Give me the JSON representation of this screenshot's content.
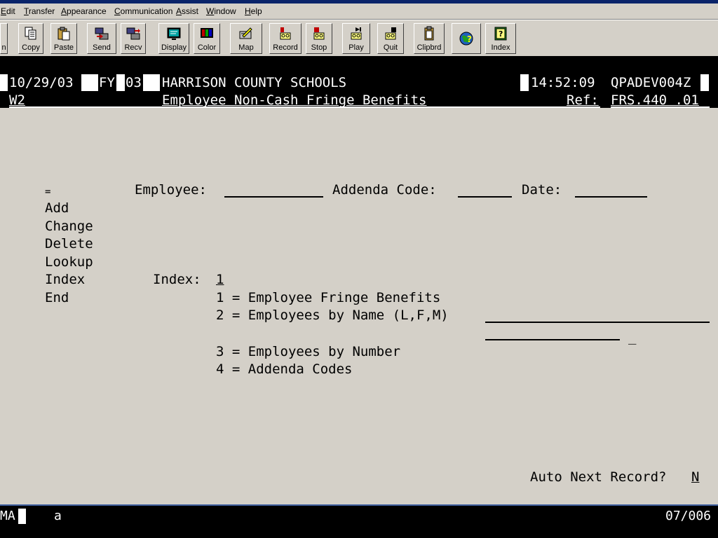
{
  "menu": {
    "items": [
      "Edit",
      "Transfer",
      "Appearance",
      "Communication",
      "Assist",
      "Window",
      "Help"
    ]
  },
  "toolbar": {
    "buttons": [
      {
        "label": "n",
        "icon": "open-icon"
      },
      {
        "label": "Copy",
        "icon": "copy-icon"
      },
      {
        "label": "Paste",
        "icon": "paste-icon"
      },
      {
        "label": "Send",
        "icon": "send-icon"
      },
      {
        "label": "Recv",
        "icon": "receive-icon"
      },
      {
        "label": "Display",
        "icon": "display-icon"
      },
      {
        "label": "Color",
        "icon": "color-icon"
      },
      {
        "label": "Map",
        "icon": "map-icon"
      },
      {
        "label": "Record",
        "icon": "record-icon"
      },
      {
        "label": "Stop",
        "icon": "stop-icon"
      },
      {
        "label": "Play",
        "icon": "play-icon"
      },
      {
        "label": "Quit",
        "icon": "quit-icon"
      },
      {
        "label": "Clipbrd",
        "icon": "clipboard-icon"
      },
      {
        "label": "",
        "icon": "help-globe-icon"
      },
      {
        "label": "Index",
        "icon": "index-icon"
      }
    ]
  },
  "header": {
    "date": "10/29/03",
    "fy_label": "FY",
    "fy_value": "03",
    "org": "HARRISON COUNTY SCHOOLS",
    "time": "14:52:09",
    "program_id": "QPADEV004Z",
    "screen_code": "W2",
    "screen_title": "Employee Non-Cash Fringe Benefits",
    "ref_label": "Ref:",
    "ref_value": "FRS.440 .01"
  },
  "form": {
    "action_field": "=",
    "employee_label": "Employee:",
    "addenda_label": "Addenda Code:",
    "date_label": "Date:",
    "actions": [
      "Add",
      "Change",
      "Delete",
      "Lookup",
      "Index",
      "End"
    ],
    "index_label": "Index:",
    "index_value": "1",
    "index_options": [
      "1 = Employee Fringe Benefits",
      "2 = Employees by Name (L,F,M)",
      "3 = Employees by Number",
      "4 = Addenda Codes"
    ],
    "name_extra_field": "_",
    "auto_next_label": "Auto Next Record?",
    "auto_next_value": "N"
  },
  "status": {
    "mode": "MA",
    "indicator": "a",
    "cursor_pos": "07/006"
  }
}
